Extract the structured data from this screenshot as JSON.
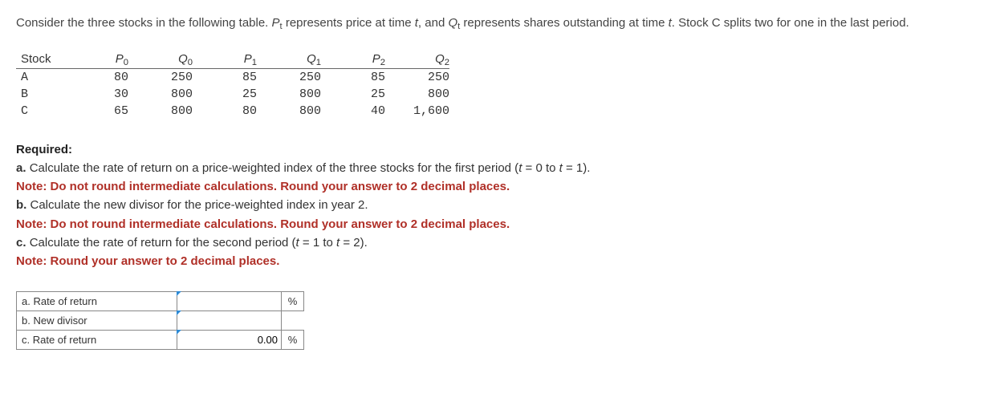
{
  "intro": {
    "part1": "Consider the three stocks in the following table. ",
    "pvar": "P",
    "psub": "t",
    "part2": " represents price at time ",
    "tvar": "t",
    "part3": ", and ",
    "qvar": "Q",
    "qsub": "t",
    "part4": " represents shares outstanding at time ",
    "part5": ". Stock C splits two for one in the last period."
  },
  "table": {
    "headers": {
      "stock": "Stock",
      "p0a": "P",
      "p0b": "0",
      "q0a": "Q",
      "q0b": "0",
      "p1a": "P",
      "p1b": "1",
      "q1a": "Q",
      "q1b": "1",
      "p2a": "P",
      "p2b": "2",
      "q2a": "Q",
      "q2b": "2"
    },
    "rows": [
      {
        "stock": "A",
        "p0": "80",
        "q0": "250",
        "p1": "85",
        "q1": "250",
        "p2": "85",
        "q2": "250"
      },
      {
        "stock": "B",
        "p0": "30",
        "q0": "800",
        "p1": "25",
        "q1": "800",
        "p2": "25",
        "q2": "800"
      },
      {
        "stock": "C",
        "p0": "65",
        "q0": "800",
        "p1": "80",
        "q1": "800",
        "p2": "40",
        "q2": "1,600"
      }
    ]
  },
  "required": {
    "header": "Required:",
    "a_label": "a. ",
    "a_text1": "Calculate the rate of return on a price-weighted index of the three stocks for the first period (",
    "a_t0": "t",
    "a_eq0": " = 0 to ",
    "a_t1": "t",
    "a_eq1": " = 1).",
    "a_note": "Note: Do not round intermediate calculations. Round your answer to 2 decimal places.",
    "b_label": "b. ",
    "b_text": "Calculate the new divisor for the price-weighted index in year 2.",
    "b_note": "Note: Do not round intermediate calculations. Round your answer to 2 decimal places.",
    "c_label": "c. ",
    "c_text1": "Calculate the rate of return for the second period (",
    "c_t0": "t",
    "c_eq0": " = 1 to ",
    "c_t1": "t",
    "c_eq1": " = 2).",
    "c_note": "Note: Round your answer to 2 decimal places."
  },
  "answers": {
    "a": {
      "label": "a. Rate of return",
      "value": "",
      "unit": "%"
    },
    "b": {
      "label": "b. New divisor",
      "value": "",
      "unit": ""
    },
    "c": {
      "label": "c. Rate of return",
      "value": "0.00",
      "unit": "%"
    }
  }
}
